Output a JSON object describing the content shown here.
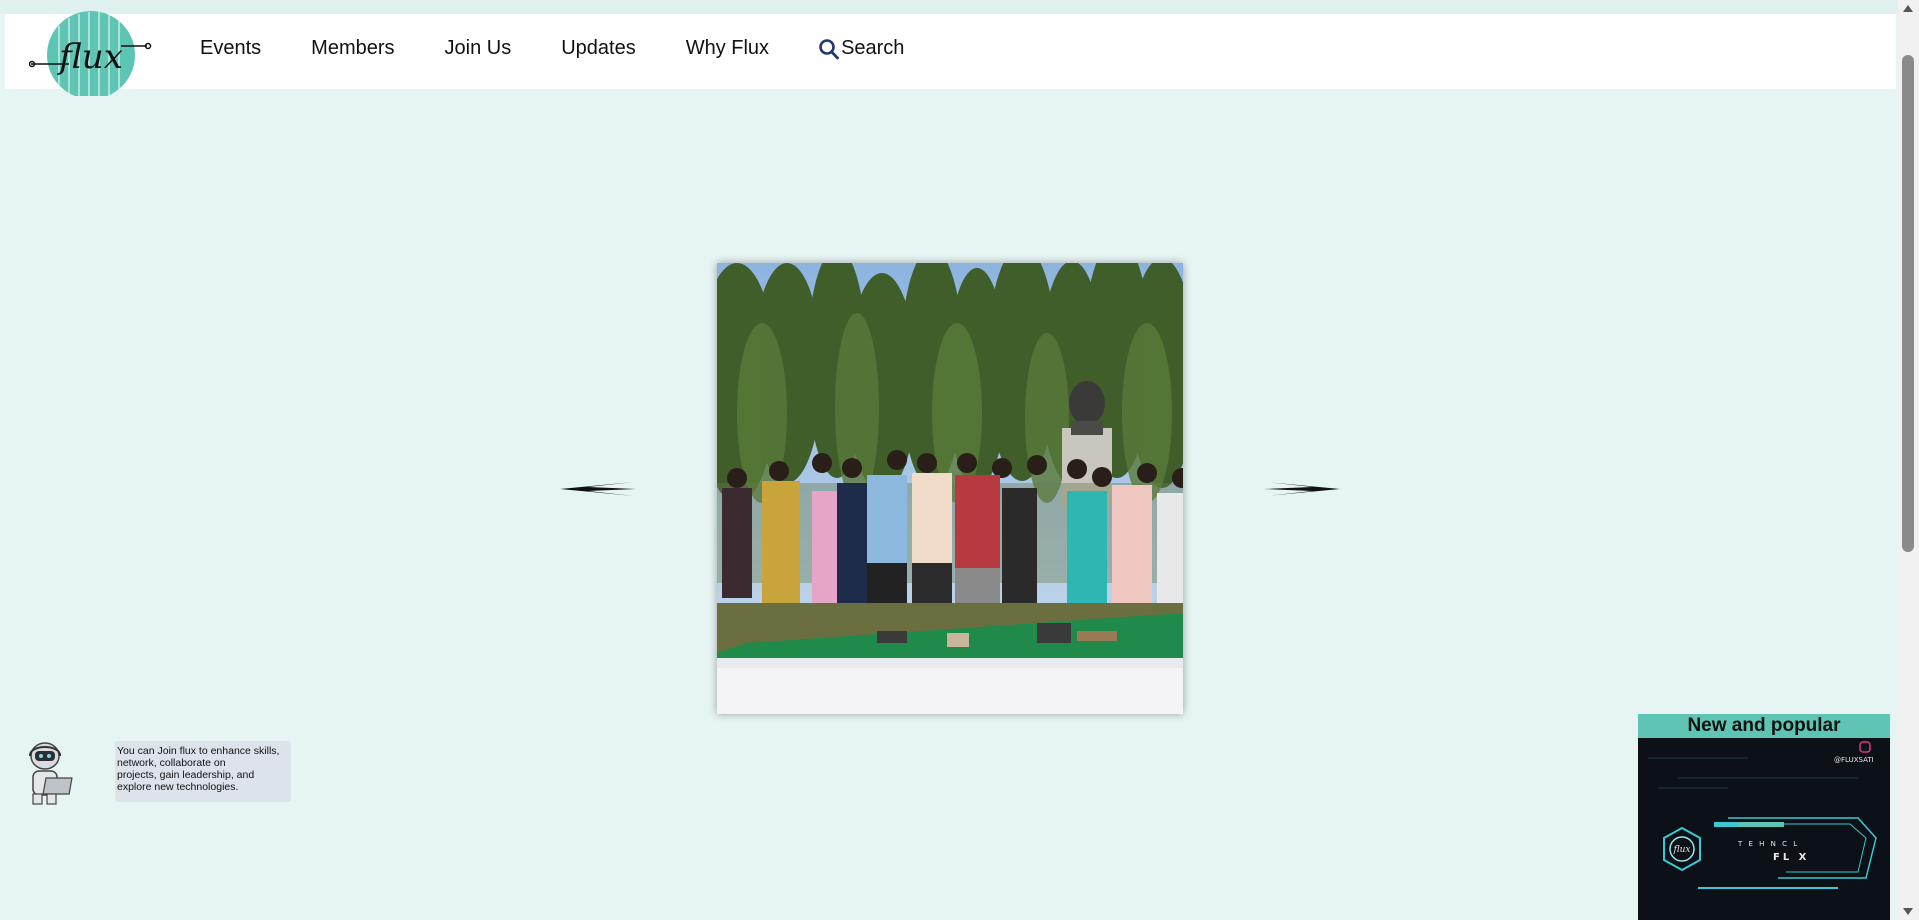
{
  "nav": {
    "logo_text": "flux",
    "links": [
      "Events",
      "Members",
      "Join Us",
      "Updates",
      "Why Flux"
    ],
    "search_label": "Search"
  },
  "slider": {
    "image_description_icon": "group-photo",
    "prev_icon": "arrow-left-icon",
    "next_icon": "arrow-right-icon"
  },
  "assistant": {
    "message_lines": [
      "You can Join flux to enhance skills,",
      "network, collaborate on",
      "projects, gain leadership, and",
      "explore new technologies."
    ]
  },
  "popular": {
    "title": "New and popular",
    "handle": "@FLUXSATI",
    "poster_logo_text": "flux",
    "poster_text_top": "T E  H N  C  L",
    "poster_text_main": "FL  X"
  },
  "colors": {
    "accent": "#5ec4b3",
    "page_bg": "#e6f4f4",
    "nav_bg": "#ffffff"
  }
}
